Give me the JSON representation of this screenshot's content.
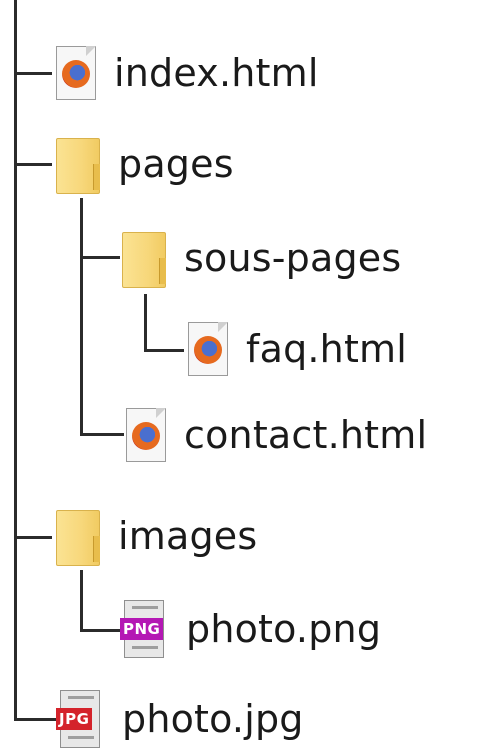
{
  "tree": {
    "items": [
      {
        "name": "index.html",
        "type": "html-file"
      },
      {
        "name": "pages",
        "type": "folder"
      },
      {
        "name": "sous-pages",
        "type": "folder"
      },
      {
        "name": "faq.html",
        "type": "html-file"
      },
      {
        "name": "contact.html",
        "type": "html-file"
      },
      {
        "name": "images",
        "type": "folder"
      },
      {
        "name": "photo.png",
        "type": "image-file",
        "badge": "PNG",
        "badge_color": "#b417b4"
      },
      {
        "name": "photo.jpg",
        "type": "image-file",
        "badge": "JPG",
        "badge_color": "#d4232b"
      }
    ]
  },
  "icons": {
    "folder": "folder-icon",
    "html_file": "firefox-document-icon",
    "image_file": "image-file-icon"
  },
  "colors": {
    "line": "#2b2b2b",
    "folder": "#f7d77a"
  }
}
